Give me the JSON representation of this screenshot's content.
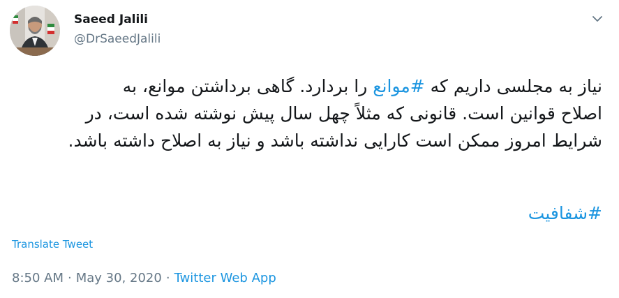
{
  "author": {
    "display_name": "Saeed Jalili",
    "handle": "@DrSaeedJalili"
  },
  "icons": {
    "avatar": "profile-photo",
    "menu": "chevron-down-icon"
  },
  "tweet": {
    "lines": [
      {
        "before": "نیاز به مجلسی داریم که ",
        "hashtag": "#موانع",
        "after": " را بردارد. گاهی برداشتن موانع، به"
      },
      {
        "text": "اصلاح قوانین است. قانونی که مثلاً چهل سال پیش نوشته شده است، در"
      },
      {
        "text": "شرایط امروز ممکن است کارایی نداشته باشد و نیاز به اصلاح داشته باشد."
      }
    ],
    "trailing_hashtag": "#شفافیت"
  },
  "translate_label": "Translate Tweet",
  "meta": {
    "time": "8:50 AM",
    "separator": "·",
    "date": "May 30, 2020",
    "source": "Twitter Web App"
  },
  "colors": {
    "link": "#1b95e0",
    "secondary_text": "#657786",
    "primary_text": "#14171a"
  }
}
